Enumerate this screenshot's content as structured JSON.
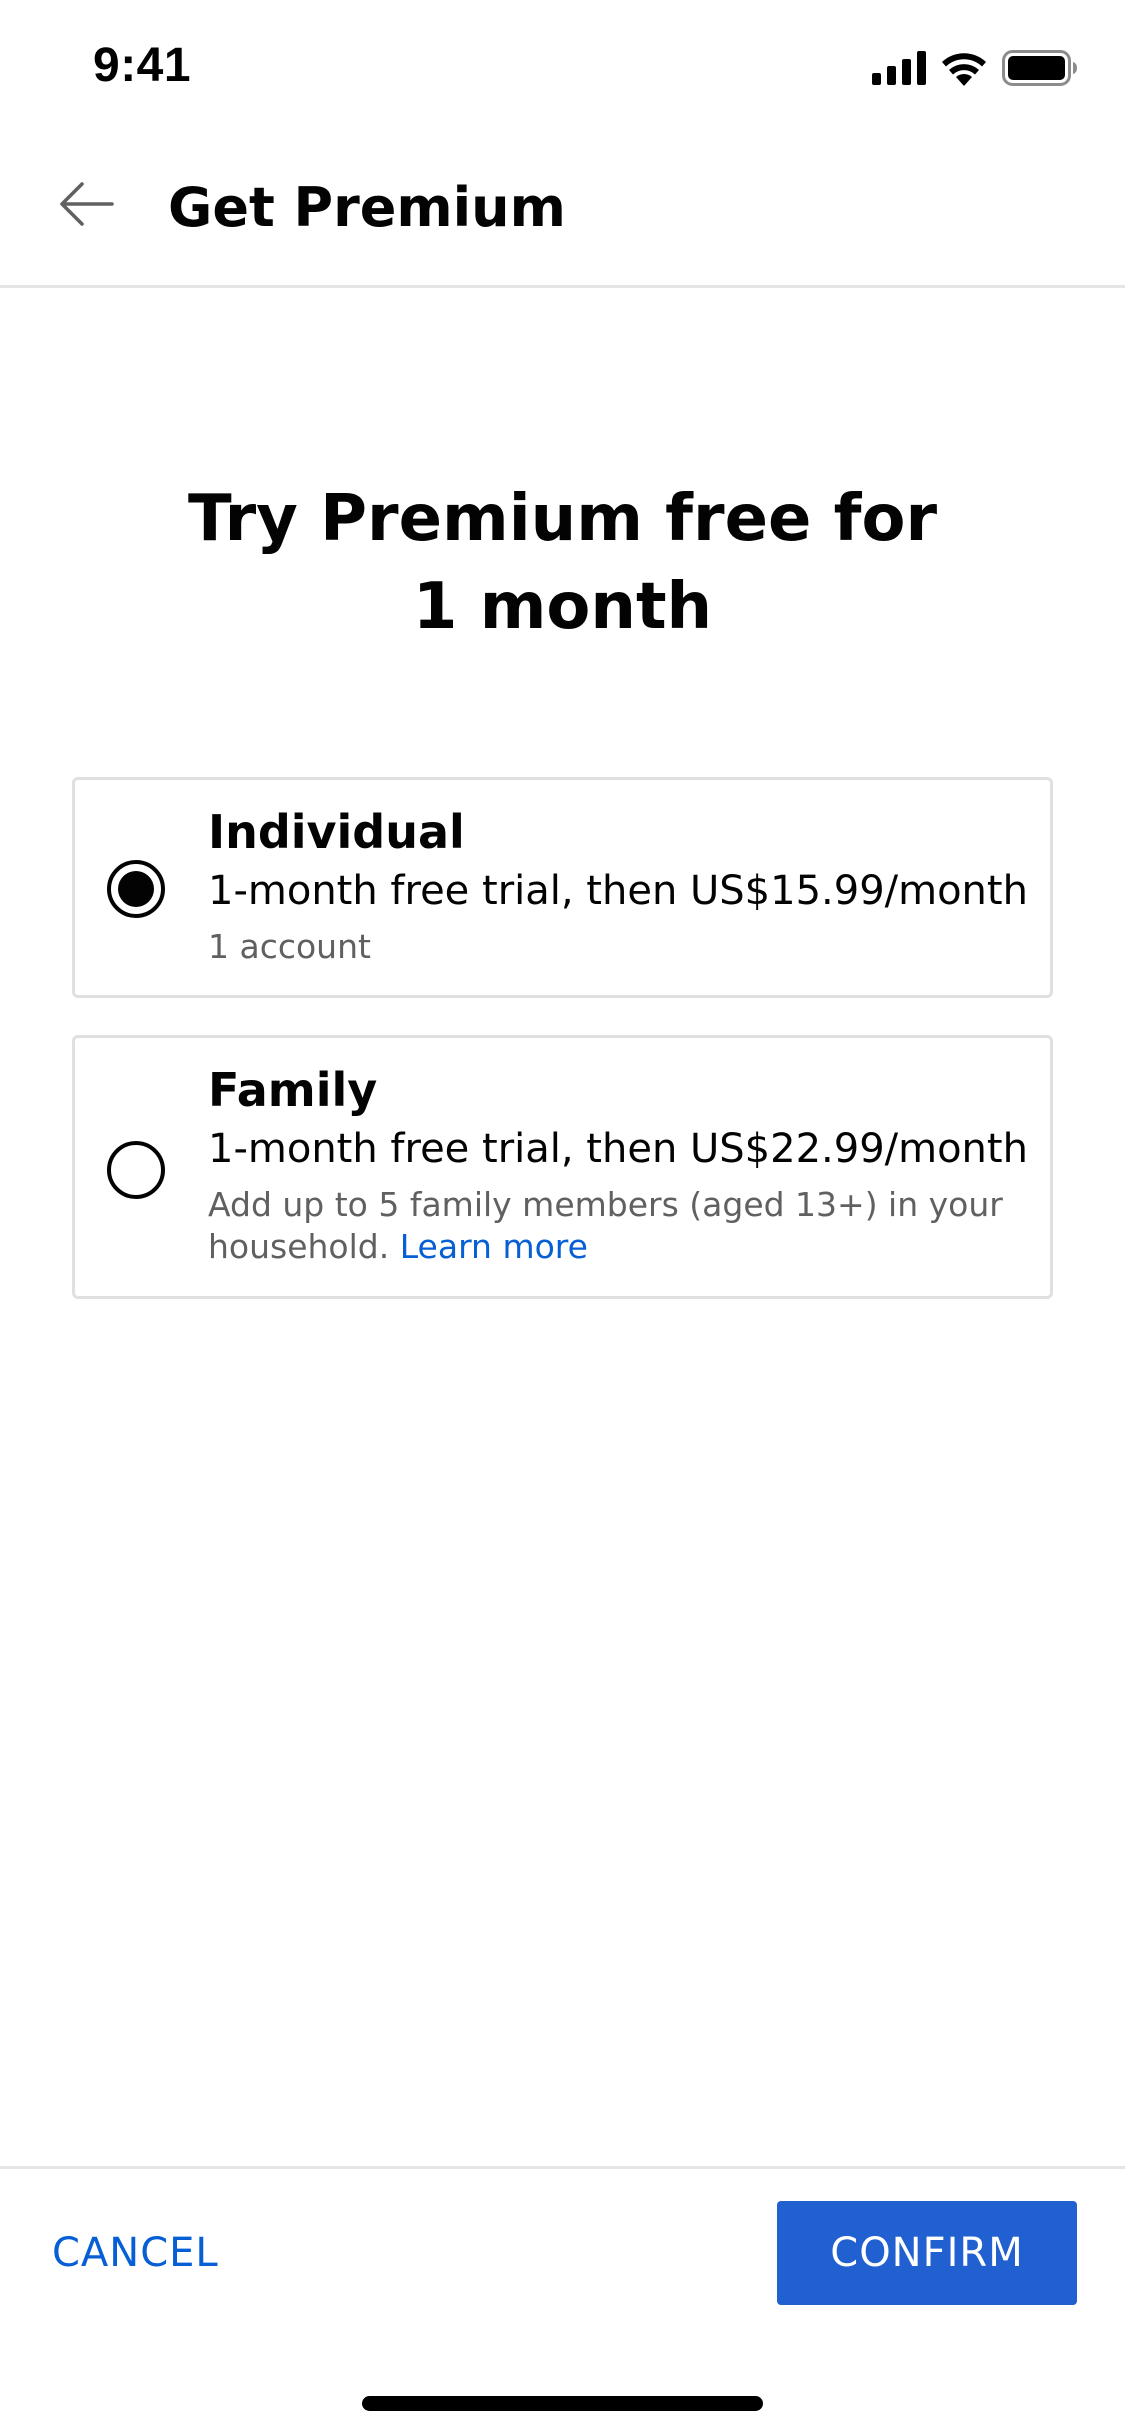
{
  "status_bar": {
    "time": "9:41",
    "icons": [
      "cellular-signal-icon",
      "wifi-icon",
      "battery-icon"
    ]
  },
  "header": {
    "back_icon": "arrow-left-icon",
    "title": "Get Premium"
  },
  "hero": {
    "line1": "Try Premium free for",
    "line2": "1 month"
  },
  "plans": [
    {
      "name": "Individual",
      "price": "1-month free trial, then US$15.99/month",
      "detail": "1 account",
      "selected": true
    },
    {
      "name": "Family",
      "price": "1-month free trial, then US$22.99/month",
      "detail": "Add up to 5 family members (aged 13+) in your household.",
      "link": "Learn more",
      "selected": false
    }
  ],
  "actions": {
    "cancel_label": "CANCEL",
    "confirm_label": "CONFIRM"
  },
  "colors": {
    "accent": "#065fd4",
    "confirm_bg": "#2160d0",
    "text": "#030303",
    "secondary_text": "#606060",
    "divider": "#e5e5e5"
  }
}
